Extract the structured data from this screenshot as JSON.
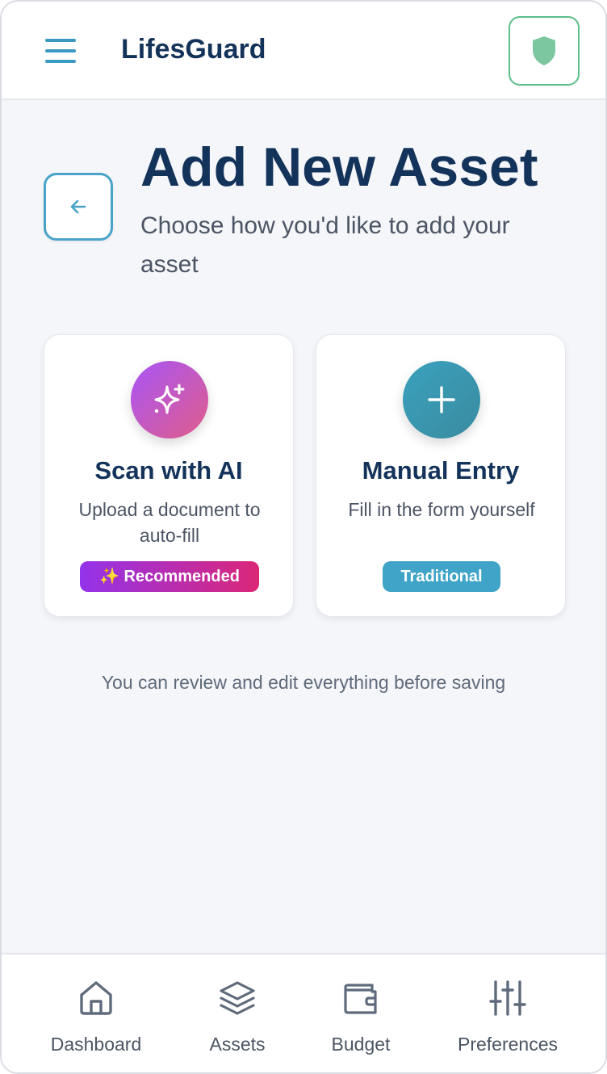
{
  "header": {
    "app_title": "LifesGuard",
    "menu_icon": "hamburger-menu-icon",
    "shield_icon": "shield-icon",
    "accent_color": "#3c9ac0",
    "shield_color": "#5cbf8a"
  },
  "page": {
    "back_icon": "arrow-left-icon",
    "title": "Add New Asset",
    "subtitle": "Choose how you'd like to add your asset"
  },
  "options": [
    {
      "icon": "sparkles-icon",
      "title": "Scan with AI",
      "description": "Upload a document to auto-fill",
      "badge": "✨ Recommended"
    },
    {
      "icon": "plus-icon",
      "title": "Manual Entry",
      "description": "Fill in the form yourself",
      "badge": "Traditional"
    }
  ],
  "footnote": "You can review and edit everything before saving",
  "bottom_nav": [
    {
      "icon": "home-icon",
      "label": "Dashboard"
    },
    {
      "icon": "layers-icon",
      "label": "Assets"
    },
    {
      "icon": "wallet-icon",
      "label": "Budget"
    },
    {
      "icon": "sliders-icon",
      "label": "Preferences"
    }
  ]
}
